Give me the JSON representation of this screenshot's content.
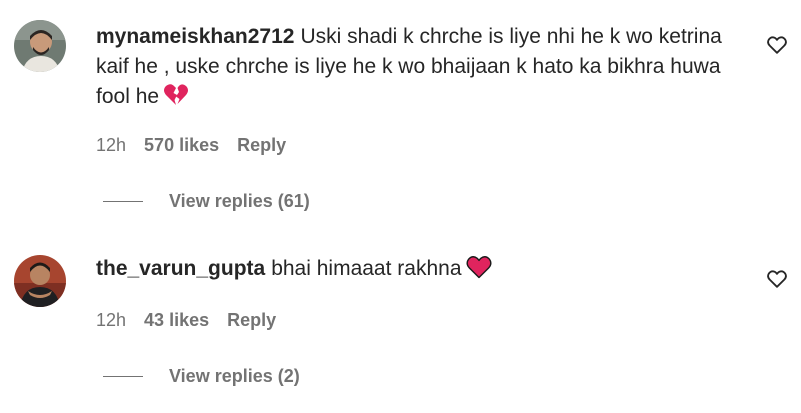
{
  "comments": [
    {
      "username": "mynameiskhan2712",
      "text": "Uski shadi k chrche is liye nhi he k wo ketrina kaif he , uske chrche is liye he k wo bhaijaan k hato ka bikhra huwa fool he",
      "emoji": "broken-heart-icon",
      "time": "12h",
      "likes": "570 likes",
      "reply_label": "Reply",
      "view_replies": "View replies (61)"
    },
    {
      "username": "the_varun_gupta",
      "text": "bhai himaaat rakhna",
      "emoji": "red-heart-icon",
      "time": "12h",
      "likes": "43 likes",
      "reply_label": "Reply",
      "view_replies": "View replies (2)"
    }
  ],
  "colors": {
    "text_primary": "#262626",
    "text_secondary": "#737373",
    "emoji_red": "#e0245e"
  }
}
